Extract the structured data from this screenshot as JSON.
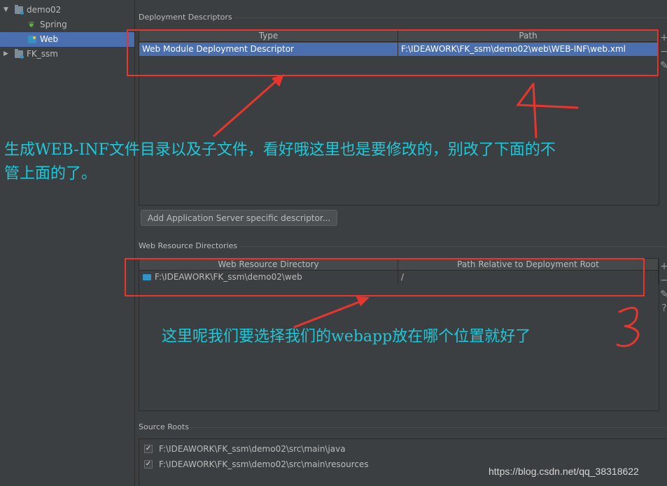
{
  "tree": {
    "items": [
      {
        "label": "demo02",
        "expanded": true,
        "selected": false
      },
      {
        "label": "Spring",
        "selected": false
      },
      {
        "label": "Web",
        "selected": true
      },
      {
        "label": "FK_ssm",
        "expanded": false,
        "selected": false
      }
    ]
  },
  "deployment": {
    "section_title": "Deployment Descriptors",
    "columns": [
      "Type",
      "Path"
    ],
    "rows": [
      {
        "type": "Web Module Deployment Descriptor",
        "path": "F:\\IDEAWORK\\FK_ssm\\demo02\\web\\WEB-INF\\web.xml",
        "selected": true
      }
    ],
    "add_button_label": "Add Application Server specific descriptor..."
  },
  "web_resources": {
    "section_title": "Web Resource Directories",
    "columns": [
      "Web Resource Directory",
      "Path Relative to Deployment Root"
    ],
    "rows": [
      {
        "directory": "F:\\IDEAWORK\\FK_ssm\\demo02\\web",
        "relative": "/"
      }
    ]
  },
  "source_roots": {
    "section_title": "Source Roots",
    "items": [
      {
        "path": "F:\\IDEAWORK\\FK_ssm\\demo02\\src\\main\\java",
        "checked": true
      },
      {
        "path": "F:\\IDEAWORK\\FK_ssm\\demo02\\src\\main\\resources",
        "checked": true
      }
    ]
  },
  "side_tools": {
    "add": "+",
    "remove": "−",
    "edit": "✎",
    "help": "?"
  },
  "annotations": {
    "note_top_line1": "生成WEB-INF文件目录以及子文件，看好哦这里也是要修改的，别改了下面的不",
    "note_top_line2": "管上面的了。",
    "note_bottom": "这里呢我们要选择我们的webapp放在哪个位置就好了",
    "number_top": "4",
    "number_bottom": "3",
    "color_red": "#e8362f",
    "color_cyan": "#1ec8d8"
  },
  "watermark": "https://blog.csdn.net/qq_38318622",
  "colors": {
    "selection": "#4b6eaf",
    "background": "#3c3f41"
  }
}
